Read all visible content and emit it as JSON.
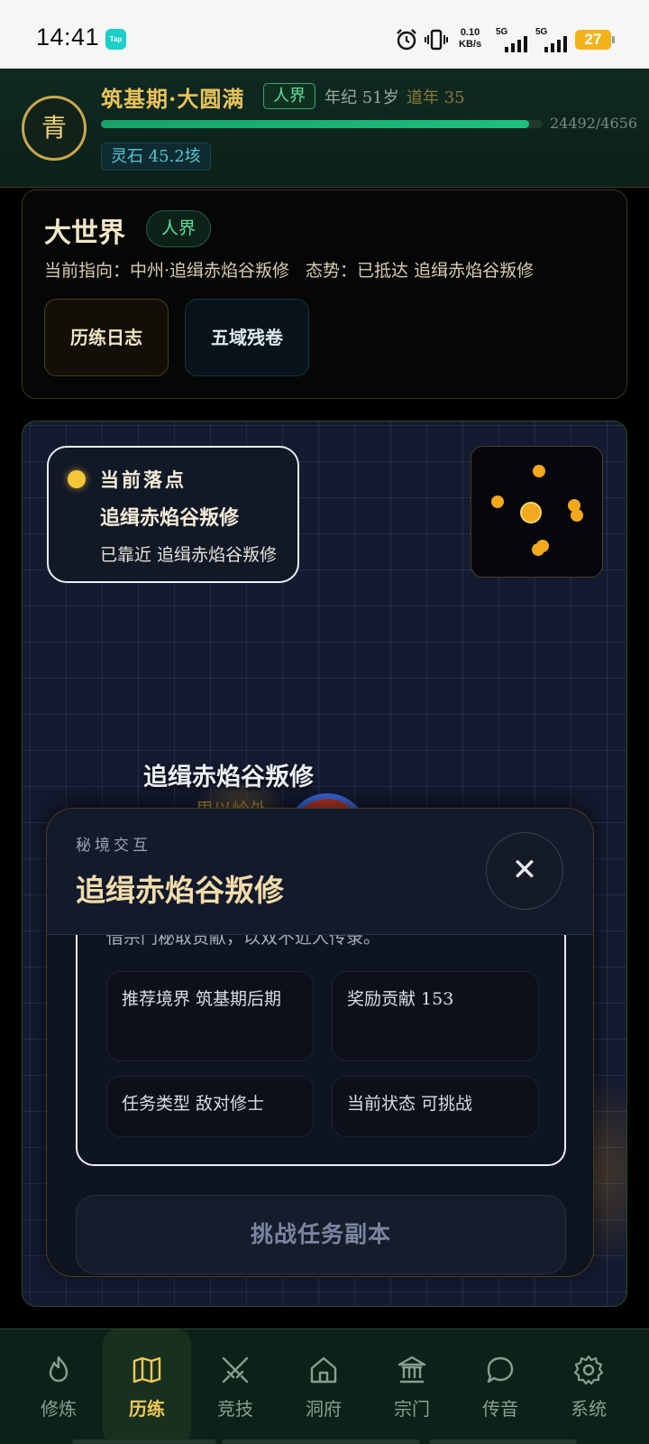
{
  "status_bar": {
    "time": "14:41",
    "app_badge": "Tap",
    "net_speed_value": "0.10",
    "net_speed_unit": "KB/s",
    "sim1_label": "5G",
    "sim2_label": "5G",
    "battery": "27"
  },
  "header": {
    "avatar_char": "青",
    "realm": "筑基期·大圆满",
    "world_tag": "人界",
    "age": "年纪 51岁",
    "dao_year": "道年 35",
    "exp_text": "24492/4656",
    "exp_progress": 0.97,
    "spirit_stone": "灵石 45.2垓"
  },
  "world_card": {
    "title": "大世界",
    "tag": "人界",
    "direction": "当前指向：中州·追缉赤焰谷叛修",
    "situation": "态势：已抵达 追缉赤焰谷叛修",
    "log_button": "历练日志",
    "scroll_button": "五域残卷"
  },
  "map": {
    "landing": {
      "label": "当前落点",
      "place": "追缉赤焰谷叛修",
      "status": "已靠近 追缉赤焰谷叛修"
    },
    "node_label": "追缉赤焰谷叛修",
    "node_sub": "里以岭外"
  },
  "modal": {
    "eyebrow": "秘境交互",
    "title": "追缉赤焰谷叛修",
    "close_glyph": "✕",
    "description": "借宗门秘取贡献，以双不近人传录。",
    "stats": {
      "recommended_realm": "推荐境界 筑基期后期",
      "reward": "奖励贡献 153",
      "task_type": "任务类型 敌对修士",
      "status": "当前状态 可挑战"
    },
    "challenge_button": "挑战任务副本"
  },
  "nav": {
    "items": [
      {
        "label": "修炼",
        "icon": "flame-icon"
      },
      {
        "label": "历练",
        "icon": "map-icon"
      },
      {
        "label": "竞技",
        "icon": "crossed-swords-icon"
      },
      {
        "label": "洞府",
        "icon": "home-icon"
      },
      {
        "label": "宗门",
        "icon": "temple-icon"
      },
      {
        "label": "传音",
        "icon": "chat-bubble-icon"
      },
      {
        "label": "系统",
        "icon": "gear-icon"
      }
    ],
    "active_index": 1
  },
  "colors": {
    "gold": "#e9c35a",
    "green_accent": "#5fe09a",
    "map_bg": "#141a30",
    "nav_bg": "#0c2219"
  }
}
